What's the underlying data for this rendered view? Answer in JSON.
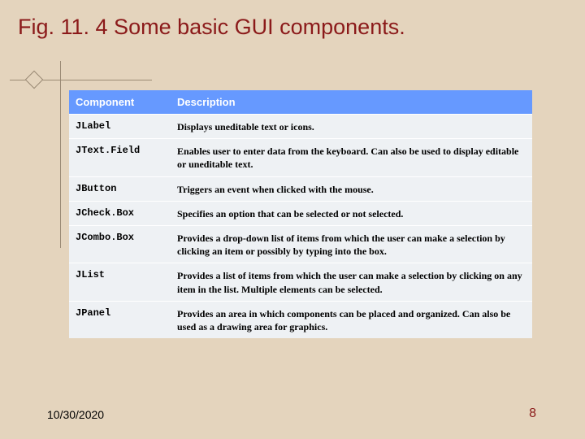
{
  "title": "Fig. 11. 4   Some basic GUI components.",
  "table": {
    "headers": {
      "component": "Component",
      "description": "Description"
    },
    "rows": [
      {
        "component": "JLabel",
        "description": "Displays uneditable text or icons."
      },
      {
        "component": "JText.Field",
        "description": "Enables user to enter data from the keyboard. Can also be used to display editable or uneditable text."
      },
      {
        "component": "JButton",
        "description": "Triggers an event when clicked with the mouse."
      },
      {
        "component": "JCheck.Box",
        "description": "Specifies an option that can be selected or not selected."
      },
      {
        "component": "JCombo.Box",
        "description": "Provides a drop-down list of items from which the user can make a selection by clicking an item or possibly by typing into the box."
      },
      {
        "component": "JList",
        "description": "Provides a list of items from which the user can make a selection by clicking on any item in the list. Multiple elements can be selected."
      },
      {
        "component": "JPanel",
        "description": "Provides an area in which components can be placed and organized. Can also be used as a drawing area for graphics."
      }
    ]
  },
  "footer": {
    "date": "10/30/2020",
    "page": "8"
  }
}
